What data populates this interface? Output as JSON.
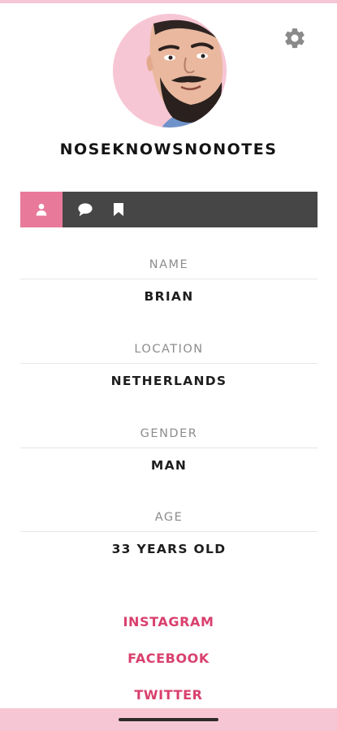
{
  "profile": {
    "username": "NOSEKNOWSNONOTES",
    "avatar_icon": "profile-photo-cartoon",
    "settings_icon": "gear-icon"
  },
  "tabs": [
    {
      "icon": "user-icon",
      "active": true
    },
    {
      "icon": "chat-bubble-icon",
      "active": false
    },
    {
      "icon": "bookmark-icon",
      "active": false
    }
  ],
  "fields": [
    {
      "label": "NAME",
      "value": "BRIAN"
    },
    {
      "label": "LOCATION",
      "value": "NETHERLANDS"
    },
    {
      "label": "GENDER",
      "value": "MAN"
    },
    {
      "label": "AGE",
      "value": "33 YEARS OLD"
    }
  ],
  "social": {
    "instagram": "INSTAGRAM",
    "facebook": "FACEBOOK",
    "twitter": "TWITTER"
  },
  "colors": {
    "accent_pink": "#e8799a",
    "link_pink": "#d9406e",
    "soft_pink": "#f7c6d4",
    "tabbar_dark": "#464646"
  }
}
